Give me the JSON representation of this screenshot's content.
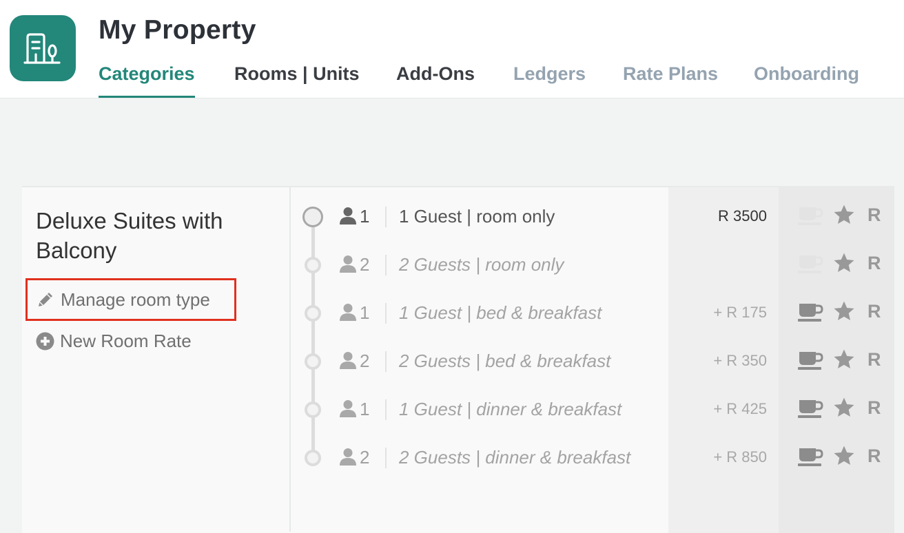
{
  "header": {
    "title": "My Property",
    "logo_icon": "building-tree-icon",
    "brand_color": "#23877a",
    "tabs": [
      {
        "label": "Categories",
        "state": "active"
      },
      {
        "label": "Rooms | Units",
        "state": "enabled"
      },
      {
        "label": "Add-Ons",
        "state": "enabled"
      },
      {
        "label": "Ledgers",
        "state": "muted"
      },
      {
        "label": "Rate Plans",
        "state": "muted"
      },
      {
        "label": "Onboarding",
        "state": "muted"
      }
    ]
  },
  "room": {
    "name": "Deluxe Suites with Balcony",
    "manage_label": "Manage room type",
    "manage_icon": "pencil-icon",
    "new_rate_label": "New Room Rate",
    "new_rate_icon": "plus-circle-icon",
    "highlight_color": "#e0301e"
  },
  "rates": [
    {
      "guests": "1",
      "name": "1 Guest | room only",
      "price": "R 3500",
      "meal_icon_active": false
    },
    {
      "guests": "2",
      "name": "2 Guests | room only",
      "price": "",
      "meal_icon_active": false
    },
    {
      "guests": "1",
      "name": "1 Guest | bed & breakfast",
      "price": "+ R 175",
      "meal_icon_active": true
    },
    {
      "guests": "2",
      "name": "2 Guests | bed & breakfast",
      "price": "+ R 350",
      "meal_icon_active": true
    },
    {
      "guests": "1",
      "name": "1 Guest | dinner & breakfast",
      "price": "+ R 425",
      "meal_icon_active": true
    },
    {
      "guests": "2",
      "name": "2 Guests | dinner & breakfast",
      "price": "+ R 850",
      "meal_icon_active": true
    }
  ],
  "row_icons": {
    "meal": "coffee-cup-icon",
    "feature": "star-icon",
    "rate_letter": "R"
  }
}
